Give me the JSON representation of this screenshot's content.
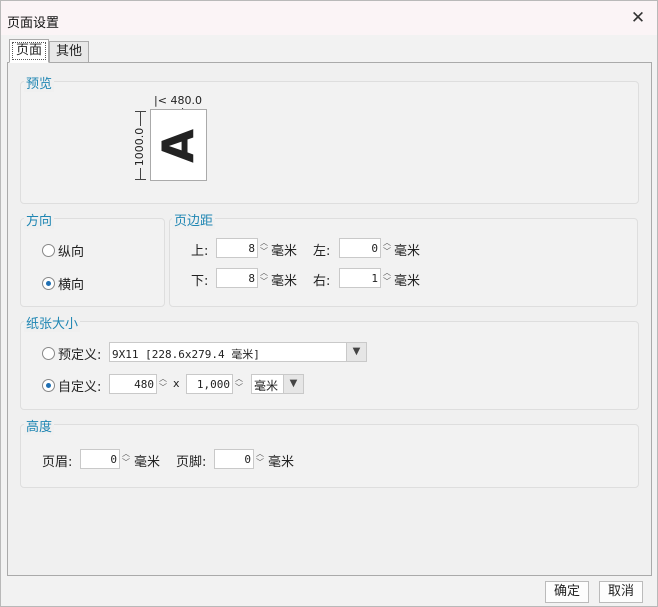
{
  "dialog": {
    "title": "页面设置"
  },
  "tabs": [
    {
      "label": "页面"
    },
    {
      "label": "其他"
    }
  ],
  "preview": {
    "label": "预览",
    "width_label": "480.0",
    "height_label": "1000.0",
    "letter": "A"
  },
  "orientation": {
    "label": "方向",
    "portrait": "纵向",
    "landscape": "横向",
    "selected": "landscape"
  },
  "margins": {
    "label": "页边距",
    "top_label": "上:",
    "top_value": "8",
    "left_label": "左:",
    "left_value": "0",
    "bottom_label": "下:",
    "bottom_value": "8",
    "right_label": "右:",
    "right_value": "1",
    "unit": "毫米"
  },
  "paper": {
    "label": "纸张大小",
    "predefined_label": "预定义:",
    "predefined_value": "9X11 [228.6x279.4 毫米]",
    "custom_label": "自定义:",
    "custom_width": "480",
    "times": "x",
    "custom_height": "1,000",
    "unit": "毫米",
    "selected": "custom"
  },
  "height_group": {
    "label": "高度",
    "header_label": "页眉:",
    "header_value": "0",
    "footer_label": "页脚:",
    "footer_value": "0",
    "unit": "毫米"
  },
  "buttons": {
    "ok": "确定",
    "cancel": "取消"
  },
  "icons": {
    "close": "close-icon",
    "dropdown": "chevron-down-icon",
    "spin": "spin-arrows-icon"
  }
}
